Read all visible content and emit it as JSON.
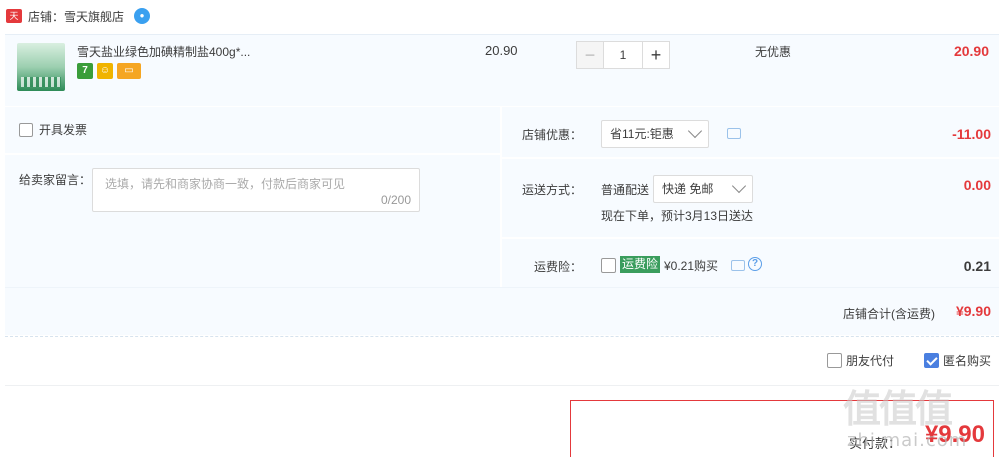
{
  "shop": {
    "logo_text": "天猫",
    "label": "店铺：",
    "name": "雪天旗舰店",
    "wangwang_icon": "wangwang-chat-icon"
  },
  "item": {
    "title": "雪天盐业绿色加碘精制盐400g*...",
    "unit_price": "20.90",
    "quantity": "1",
    "minus_label": "−",
    "plus_label": "+",
    "discount_text": "无优惠",
    "subtotal": "20.90",
    "service_icons": [
      "seven-day-return-icon",
      "guarantee-badge-icon",
      "credit-card-icon"
    ],
    "service_seven_text": "7"
  },
  "invoice": {
    "label": "开具发票",
    "checked": false
  },
  "message": {
    "label": "给卖家留言：",
    "placeholder": "选填，请先和商家协商一致，付款后商家可见",
    "counter": "0/200"
  },
  "shop_discount": {
    "label": "店铺优惠：",
    "selected": "省11元:钜惠",
    "amount": "-11.00"
  },
  "delivery": {
    "label": "运送方式：",
    "method": "普通配送",
    "selected": "快递 免邮",
    "eta": "现在下单，预计3月13日送达",
    "amount": "0.00"
  },
  "insurance": {
    "label": "运费险：",
    "badge": "运费险",
    "price_text": "¥0.21购买",
    "help_glyph": "?",
    "amount": "0.21",
    "checked": false
  },
  "shop_total": {
    "label": "店铺合计(含运费)",
    "value": "¥9.90"
  },
  "options": {
    "friend_pay": {
      "label": "朋友代付",
      "checked": false
    },
    "anonymous": {
      "label": "匿名购买",
      "checked": true
    }
  },
  "payment": {
    "label": "实付款：",
    "value": "¥9.90"
  },
  "watermark": {
    "logo": "值值值",
    "url": "zhi.mai.com"
  },
  "colors": {
    "accent_red": "#e4393c",
    "panel_bg": "#f7fbff",
    "checkbox_checked": "#4a7fe0",
    "insurance_badge": "#3a9d5d"
  }
}
